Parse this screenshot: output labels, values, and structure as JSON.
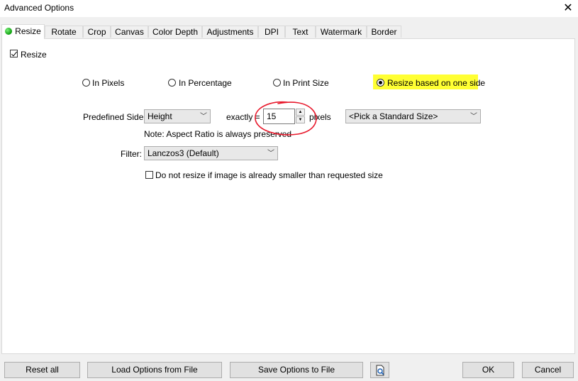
{
  "window": {
    "title": "Advanced Options",
    "close_glyph": "✕"
  },
  "tabs": [
    {
      "label": "Resize",
      "active": true
    },
    {
      "label": "Rotate"
    },
    {
      "label": "Crop"
    },
    {
      "label": "Canvas"
    },
    {
      "label": "Color Depth"
    },
    {
      "label": "Adjustments"
    },
    {
      "label": "DPI"
    },
    {
      "label": "Text"
    },
    {
      "label": "Watermark"
    },
    {
      "label": "Border"
    }
  ],
  "resize": {
    "enable_label": "Resize",
    "enabled": true,
    "modes": [
      {
        "label": "In Pixels",
        "selected": false
      },
      {
        "label": "In Percentage",
        "selected": false
      },
      {
        "label": "In Print Size",
        "selected": false
      },
      {
        "label": "Resize based on one side",
        "selected": true
      }
    ],
    "predefined_side_label": "Predefined Side:",
    "predefined_side_value": "Height",
    "exactly_label": "exactly =",
    "exactly_value": "15",
    "pixels_label": "pixels",
    "standard_size_value": "<Pick a Standard Size>",
    "note": "Note: Aspect Ratio is always preserved",
    "filter_label": "Filter:",
    "filter_value": "Lanczos3 (Default)",
    "no_upscale_label": "Do not resize if image is already smaller than requested size",
    "no_upscale_checked": false
  },
  "footer": {
    "reset_label": "Reset all",
    "load_label": "Load Options from File",
    "save_label": "Save Options to File",
    "ok_label": "OK",
    "cancel_label": "Cancel"
  },
  "colors": {
    "highlight": "#ffff33",
    "annotation": "#e8192c",
    "active_dot": "#0a9c0a"
  }
}
